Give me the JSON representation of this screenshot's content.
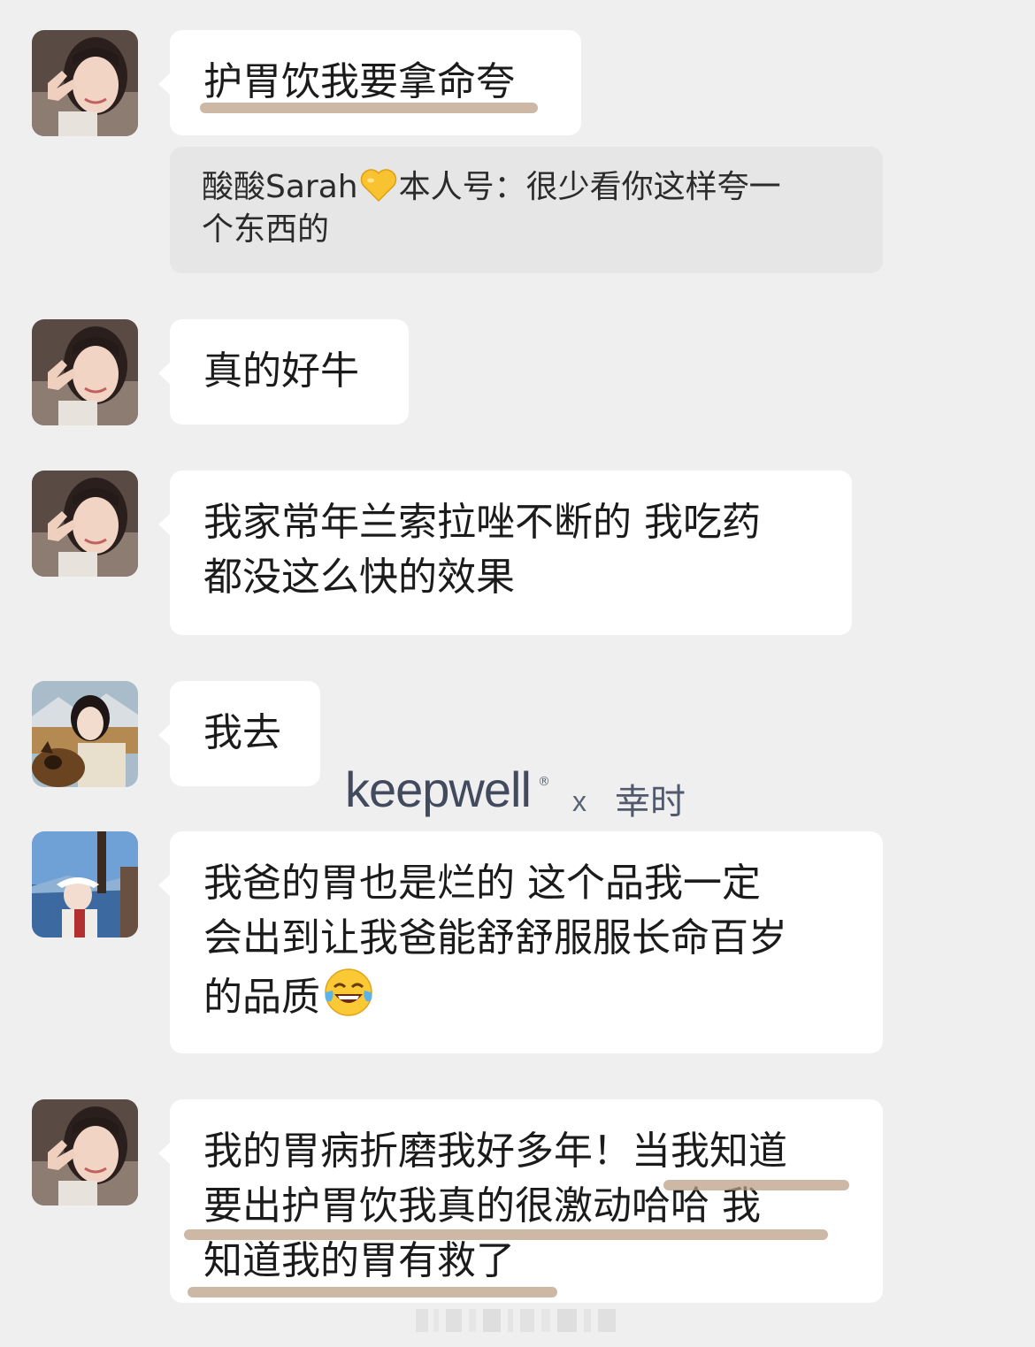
{
  "messages": [
    {
      "id": 1,
      "avatar": "avatar-woman-v-sign",
      "text": "护胃饮我要拿命夸"
    },
    {
      "id": 2,
      "avatar": "avatar-woman-v-sign",
      "text": "真的好牛"
    },
    {
      "id": 3,
      "avatar": "avatar-woman-v-sign",
      "lines": [
        "我家常年兰索拉唑不断的 我吃药",
        "都没这么快的效果"
      ]
    },
    {
      "id": 4,
      "avatar": "avatar-woman-with-dog",
      "text": "我去"
    },
    {
      "id": 5,
      "avatar": "avatar-woman-sun-visor",
      "lines": [
        "我爸的胃也是烂的 这个品我一定",
        "会出到让我爸能舒舒服服长命百岁",
        "的品质"
      ],
      "emoji": "tears-of-joy-emoji"
    },
    {
      "id": 6,
      "avatar": "avatar-woman-v-sign",
      "lines": [
        "我的胃病折磨我好多年！当我知道",
        "要出护胃饮我真的很激动哈哈 我",
        "知道我的胃有救了"
      ]
    }
  ],
  "quote": {
    "author": "酸酸Sarah",
    "emoji": "yellow-heart-emoji",
    "label": "本人号：很少看你这样夸一",
    "line2": "个东西的"
  },
  "watermark": {
    "brand": "keepwell",
    "registered": "®",
    "separator": "x",
    "partner": "幸时"
  },
  "colors": {
    "background": "#efefef",
    "bubble": "#ffffff",
    "quote_background": "#e6e6e6",
    "highlight": "#b89c82",
    "watermark": "#424a5e"
  }
}
